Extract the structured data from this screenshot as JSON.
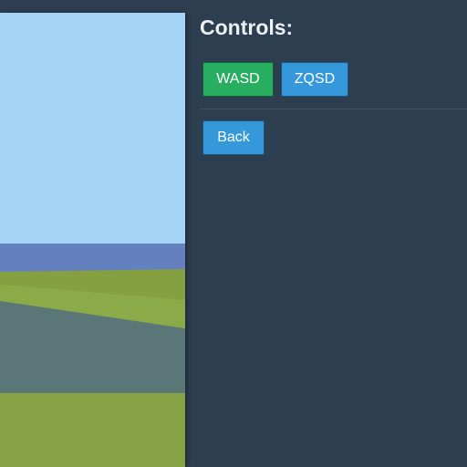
{
  "panel": {
    "title": "Controls:",
    "buttons": {
      "wasd": "WASD",
      "zqsd": "ZQSD",
      "back": "Back"
    }
  },
  "colors": {
    "background": "#2d3e50",
    "button_green": "#27ae60",
    "button_blue": "#3498db",
    "title_text": "#ecf0f1",
    "sky": "#a3d3f5",
    "water": "#6480bf",
    "grass": "#86a244",
    "path": "#5a7677"
  }
}
